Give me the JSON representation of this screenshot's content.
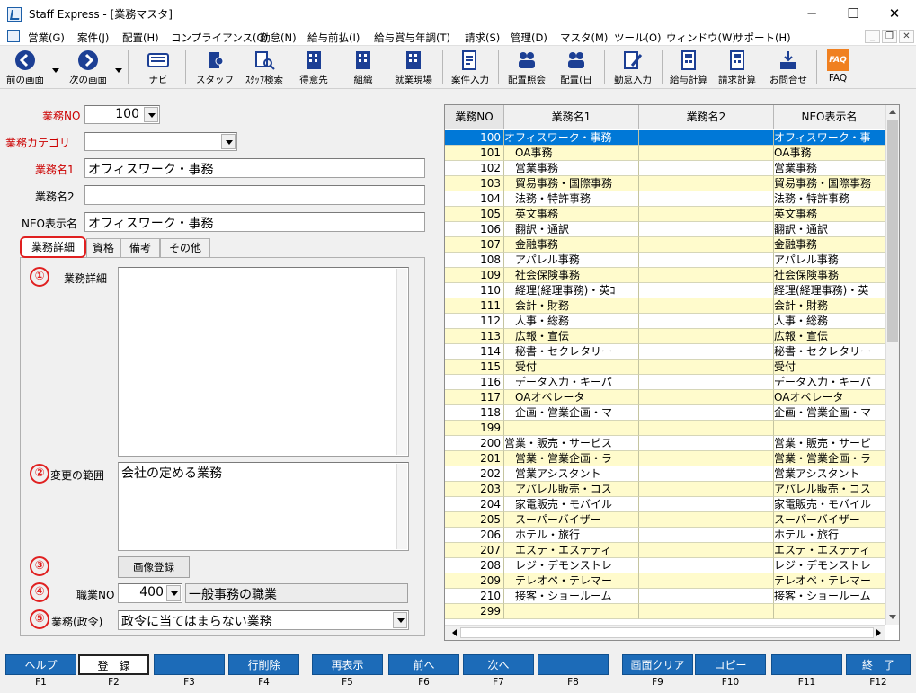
{
  "window": {
    "title": "Staff Express - [業務マスタ]",
    "minimize": "─",
    "maximize": "☐",
    "close": "✕"
  },
  "menu": [
    "営業(G)",
    "案件(J)",
    "配置(H)",
    "コンプライアンス(C)",
    "勤怠(N)",
    "給与前払(I)",
    "給与賞与年調(T)",
    "請求(S)",
    "管理(D)",
    "マスタ(M)",
    "ツール(O)",
    "ウィンドウ(W)",
    "サポート(H)"
  ],
  "mdi": {
    "min": "_",
    "restore": "❐",
    "close": "✕"
  },
  "toolbar": {
    "back": "前の画面",
    "forward": "次の画面",
    "navi": "ナビ",
    "staff": "スタッフ",
    "staff_search": "ｽﾀｯﾌ検索",
    "client": "得意先",
    "org": "組織",
    "workplace": "就業現場",
    "case": "案件入力",
    "assign_inquiry": "配置照会",
    "assign_day": "配置(日",
    "attendance": "勤怠入力",
    "payroll": "給与計算",
    "billing": "請求計算",
    "contact": "お問合せ",
    "faq": "FAQ",
    "faq_badge": "FAQ"
  },
  "form": {
    "gyomu_no_label": "業務NO",
    "gyomu_no_value": "100",
    "category_label": "業務カテゴリ",
    "category_value": "",
    "name1_label": "業務名1",
    "name1_value": "オフィスワーク・事務",
    "name2_label": "業務名2",
    "name2_value": "",
    "neo_label": "NEO表示名",
    "neo_value": "オフィスワーク・事務"
  },
  "tabs": [
    "業務詳細",
    "資格",
    "備考",
    "その他"
  ],
  "detail": {
    "markers": [
      "①",
      "②",
      "③",
      "④",
      "⑤"
    ],
    "detail_label": "業務詳細",
    "detail_value": "",
    "change_label": "変更の範囲",
    "change_value": "会社の定める業務",
    "image_button": "画像登録",
    "job_no_label": "職業NO",
    "job_no_value": "400",
    "job_name": "一般事務の職業",
    "law_label": "業務(政令)",
    "law_value": "政令に当てはまらない業務"
  },
  "grid": {
    "headers": [
      "業務NO",
      "業務名1",
      "業務名2",
      "NEO表示名"
    ],
    "rows": [
      [
        "100",
        "オフィスワーク・事務",
        "",
        "オフィスワーク・事"
      ],
      [
        "101",
        "　OA事務",
        "",
        "OA事務"
      ],
      [
        "102",
        "　営業事務",
        "",
        "営業事務"
      ],
      [
        "103",
        "　貿易事務・国際事務",
        "",
        "貿易事務・国際事務"
      ],
      [
        "104",
        "　法務・特許事務",
        "",
        "法務・特許事務"
      ],
      [
        "105",
        "　英文事務",
        "",
        "英文事務"
      ],
      [
        "106",
        "　翻訳・通訳",
        "",
        "翻訳・通訳"
      ],
      [
        "107",
        "　金融事務",
        "",
        "金融事務"
      ],
      [
        "108",
        "　アパレル事務",
        "",
        "アパレル事務"
      ],
      [
        "109",
        "　社会保険事務",
        "",
        "社会保険事務"
      ],
      [
        "110",
        "　経理(経理事務)・英ｺ",
        "",
        "経理(経理事務)・英"
      ],
      [
        "111",
        "　会計・財務",
        "",
        "会計・財務"
      ],
      [
        "112",
        "　人事・総務",
        "",
        "人事・総務"
      ],
      [
        "113",
        "　広報・宣伝",
        "",
        "広報・宣伝"
      ],
      [
        "114",
        "　秘書・セクレタリー",
        "",
        "秘書・セクレタリー"
      ],
      [
        "115",
        "　受付",
        "",
        "受付"
      ],
      [
        "116",
        "　データ入力・キーパ",
        "",
        "データ入力・キーパ"
      ],
      [
        "117",
        "　OAオペレータ",
        "",
        "OAオペレータ"
      ],
      [
        "118",
        "　企画・営業企画・マ",
        "",
        "企画・営業企画・マ"
      ],
      [
        "199",
        "",
        "",
        ""
      ],
      [
        "200",
        "営業・販売・サービス",
        "",
        "営業・販売・サービ"
      ],
      [
        "201",
        "　営業・営業企画・ラ",
        "",
        "営業・営業企画・ラ"
      ],
      [
        "202",
        "　営業アシスタント",
        "",
        "営業アシスタント"
      ],
      [
        "203",
        "　アパレル販売・コス",
        "",
        "アパレル販売・コス"
      ],
      [
        "204",
        "　家電販売・モバイル",
        "",
        "家電販売・モバイル"
      ],
      [
        "205",
        "　スーパーバイザー",
        "",
        "スーパーバイザー"
      ],
      [
        "206",
        "　ホテル・旅行",
        "",
        "ホテル・旅行"
      ],
      [
        "207",
        "　エステ・エステティ",
        "",
        "エステ・エステティ"
      ],
      [
        "208",
        "　レジ・デモンストレ",
        "",
        "レジ・デモンストレ"
      ],
      [
        "209",
        "　テレオペ・テレマー",
        "",
        "テレオペ・テレマー"
      ],
      [
        "210",
        "　接客・ショールーム",
        "",
        "接客・ショールーム"
      ],
      [
        "299",
        "",
        "",
        ""
      ]
    ]
  },
  "fkeys": [
    {
      "label": "ヘルプ",
      "key": "F1"
    },
    {
      "label": "登　録",
      "key": "F2"
    },
    {
      "label": "",
      "key": "F3"
    },
    {
      "label": "行削除",
      "key": "F4"
    },
    {
      "label": "再表示",
      "key": "F5"
    },
    {
      "label": "前へ",
      "key": "F6"
    },
    {
      "label": "次へ",
      "key": "F7"
    },
    {
      "label": "",
      "key": "F8"
    },
    {
      "label": "画面クリア",
      "key": "F9"
    },
    {
      "label": "コピー",
      "key": "F10"
    },
    {
      "label": "",
      "key": "F11"
    },
    {
      "label": "終　了",
      "key": "F12"
    }
  ],
  "colors": {
    "accent": "#1c6bb8",
    "selected_row": "#0078d7",
    "alt_row": "#fffbcc",
    "required_label": "#cc0000",
    "marker": "#e02020"
  }
}
